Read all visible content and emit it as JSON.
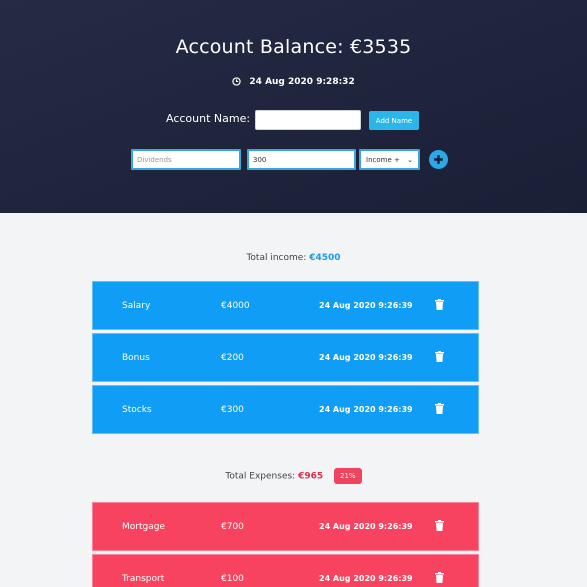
{
  "header": {
    "balance_title": "Account Balance: €3535",
    "datetime": "24 Aug 2020 9:28:32",
    "account_name_label": "Account Name:",
    "account_name_value": "",
    "add_name_button": "Add Name"
  },
  "entry_form": {
    "description_placeholder": "Dividends",
    "amount_value": "300",
    "type_selected": "Income +",
    "colors": {
      "accent": "#2bb6ea",
      "field_border": "#3aa6dd"
    }
  },
  "income": {
    "total_label": "Total income:",
    "total_amount": "€4500",
    "items": [
      {
        "name": "Salary",
        "amount": "€4000",
        "date": "24 Aug 2020 9:26:39"
      },
      {
        "name": "Bonus",
        "amount": "€200",
        "date": "24 Aug 2020 9:26:39"
      },
      {
        "name": "Stocks",
        "amount": "€300",
        "date": "24 Aug 2020 9:26:39"
      }
    ],
    "color": "#0f9df5"
  },
  "expenses": {
    "total_label": "Total Expenses:",
    "total_amount": "€965",
    "percent_badge": "21%",
    "items": [
      {
        "name": "Mortgage",
        "amount": "€700",
        "date": "24 Aug 2020 9:26:39"
      },
      {
        "name": "Transport",
        "amount": "€100",
        "date": "24 Aug 2020 9:26:39"
      }
    ],
    "color": "#f7435f"
  },
  "icons": {
    "clock": "clock-icon",
    "plus": "plus-circle-icon",
    "delete": "trash-icon"
  }
}
